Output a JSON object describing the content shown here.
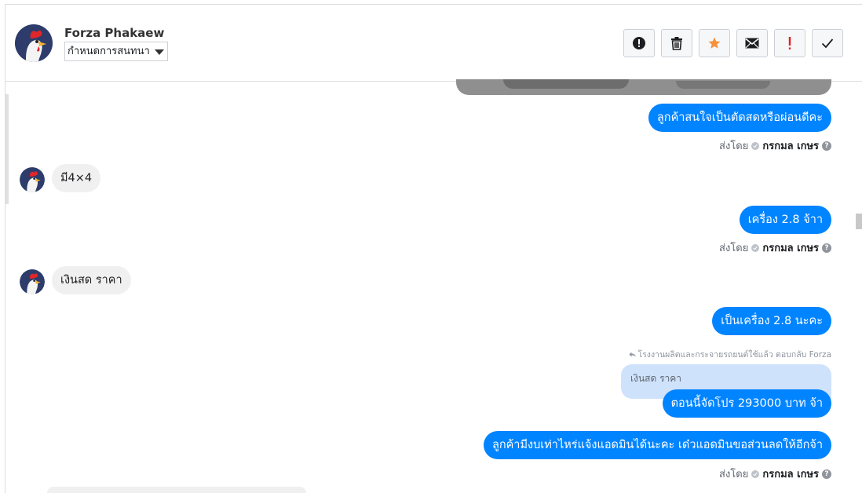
{
  "header": {
    "contact_name": "Forza Phakaew",
    "assign_select": "กำหนดการสนทนา",
    "toolbar": [
      {
        "name": "spam-button",
        "icon": "alert-circle-icon"
      },
      {
        "name": "delete-button",
        "icon": "trash-icon"
      },
      {
        "name": "star-button",
        "icon": "star-icon",
        "color": "#f7923b"
      },
      {
        "name": "mark-unread-button",
        "icon": "envelope-icon"
      },
      {
        "name": "follow-up-button",
        "icon": "exclamation-icon",
        "color": "#e02020"
      },
      {
        "name": "mark-done-button",
        "icon": "checkmark-icon"
      }
    ]
  },
  "messages": [
    {
      "id": "m1",
      "direction": "out",
      "text": "ลูกค้าสนใจเป็นตัดสดหรือผ่อนดีคะ"
    },
    {
      "id": "m2",
      "direction": "in",
      "text": "มี4×4"
    },
    {
      "id": "m3",
      "direction": "out",
      "text": "เครื่อง 2.8 จ้าา"
    },
    {
      "id": "m4",
      "direction": "in",
      "text": "เงินสด ราคา"
    },
    {
      "id": "m5",
      "direction": "out",
      "text": "เป็นเครื่อง 2.8 นะคะ"
    },
    {
      "id": "m6",
      "direction": "out",
      "text": "ตอนนี้จัดโปร 293000 บาท จ้า",
      "reply_caption": "โรงงานผลิตและกระจายรถยนต์ใช้แล้ว ตอบกลับ Forza",
      "quoted_text": "เงินสด ราคา"
    },
    {
      "id": "m7",
      "direction": "out",
      "text": "ลูกค้ามีงบเท่าไหร่แจ้งแอดมินได้นะคะ เด๋วแอดมินขอส่วนลดให้อีกจ้า"
    }
  ],
  "sent_by": {
    "prefix": "ส่งโดย",
    "agent": "กรกมล เกษร"
  }
}
